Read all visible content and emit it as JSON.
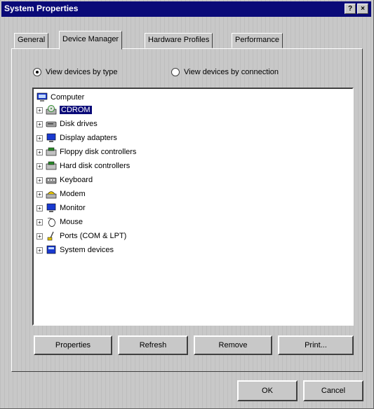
{
  "window": {
    "title": "System Properties"
  },
  "titlebar": {
    "help_glyph": "?",
    "close_glyph": "×"
  },
  "tabs": [
    {
      "label": "General"
    },
    {
      "label": "Device Manager"
    },
    {
      "label": "Hardware Profiles"
    },
    {
      "label": "Performance"
    }
  ],
  "view_options": {
    "by_type_label": "View devices by type",
    "by_connection_label": "View devices by connection",
    "selected": "by_type"
  },
  "tree": {
    "root": {
      "label": "Computer",
      "icon": "computer-icon"
    },
    "items": [
      {
        "label": "CDROM",
        "icon": "cdrom-icon",
        "selected": true
      },
      {
        "label": "Disk drives",
        "icon": "disk-drive-icon"
      },
      {
        "label": "Display adapters",
        "icon": "display-adapter-icon"
      },
      {
        "label": "Floppy disk controllers",
        "icon": "floppy-controller-icon"
      },
      {
        "label": "Hard disk controllers",
        "icon": "hard-disk-controller-icon"
      },
      {
        "label": "Keyboard",
        "icon": "keyboard-icon"
      },
      {
        "label": "Modem",
        "icon": "modem-icon"
      },
      {
        "label": "Monitor",
        "icon": "monitor-icon"
      },
      {
        "label": "Mouse",
        "icon": "mouse-icon"
      },
      {
        "label": "Ports (COM & LPT)",
        "icon": "ports-icon"
      },
      {
        "label": "System devices",
        "icon": "system-devices-icon"
      }
    ]
  },
  "actions": {
    "properties": "Properties",
    "refresh": "Refresh",
    "remove": "Remove",
    "print": "Print..."
  },
  "footer": {
    "ok": "OK",
    "cancel": "Cancel"
  },
  "colors": {
    "title_bar": "#0a0a78",
    "selection": "#0a0a78",
    "face": "#c8c8c8"
  }
}
